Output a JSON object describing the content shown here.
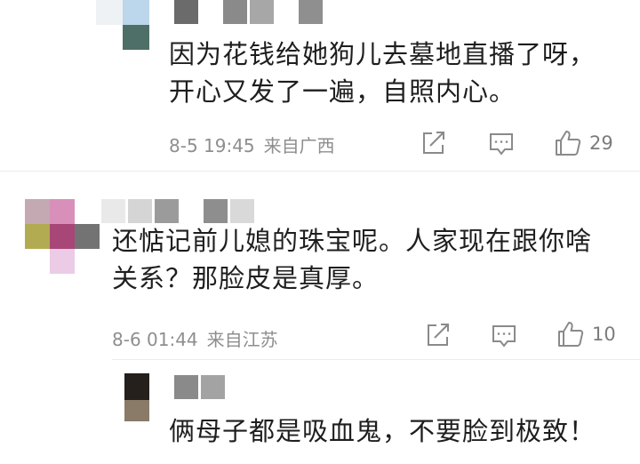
{
  "comments": [
    {
      "text_lines": [
        "因为花钱给她狗儿去墓地直播了呀，",
        "开心又发了一遍，自照内心。"
      ],
      "date": "8-5 19:45",
      "location": "来自广西",
      "likes": "29"
    },
    {
      "text_lines": [
        "还惦记前儿媳的珠宝呢。人家现在跟你啥",
        "关系？那脸皮是真厚。"
      ],
      "date": "8-6 01:44",
      "location": "来自江苏",
      "likes": "10"
    },
    {
      "text_lines": [
        "俩母子都是吸血鬼，不要脸到极致！"
      ]
    }
  ],
  "icons": {
    "share": "share-icon",
    "reply": "comment-icon",
    "like": "thumbs-up-icon"
  },
  "colors": {
    "meta_text": "#8e8e8e",
    "icon": "#8a8a8a",
    "divider": "#ececec"
  }
}
